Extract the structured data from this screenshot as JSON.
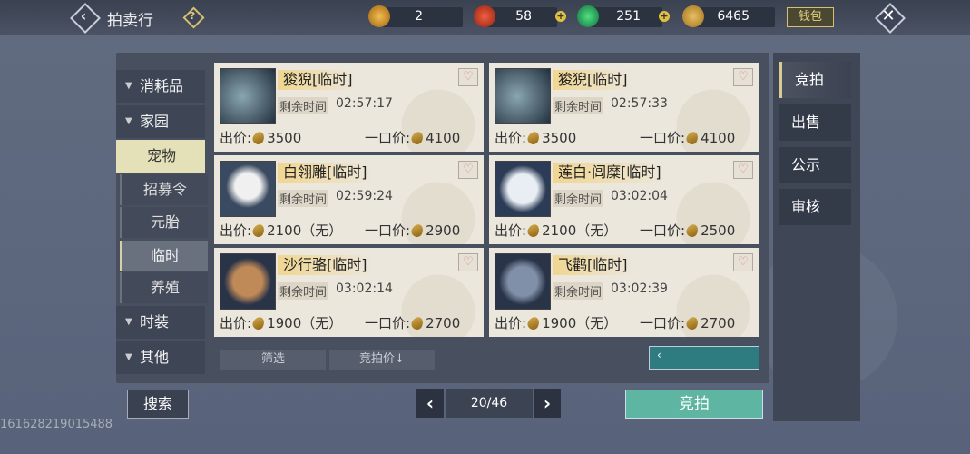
{
  "header": {
    "title": "拍卖行",
    "resources": [
      {
        "icon": "gold-medal-icon",
        "value": "2"
      },
      {
        "icon": "red-orb-icon",
        "value": "58"
      },
      {
        "icon": "jade-icon",
        "value": "251"
      },
      {
        "icon": "coin-icon",
        "value": "6465"
      }
    ],
    "wallet_label": "钱包"
  },
  "categories": [
    {
      "label": "消耗品"
    },
    {
      "label": "家园"
    },
    {
      "label": "宠物"
    },
    {
      "label": "时装"
    },
    {
      "label": "其他"
    }
  ],
  "subcategories": [
    {
      "label": "招募令"
    },
    {
      "label": "元胎"
    },
    {
      "label": "临时"
    },
    {
      "label": "养殖"
    }
  ],
  "labels": {
    "remaining_time": "剩余时间",
    "bid": "出价:",
    "buyout": "一口价:"
  },
  "listings": [
    {
      "name": "狻猊[临时]",
      "time": "02:57:17",
      "bid": "3500",
      "buyout": "4100"
    },
    {
      "name": "狻猊[临时]",
      "time": "02:57:33",
      "bid": "3500",
      "buyout": "4100"
    },
    {
      "name": "白翎雕[临时]",
      "time": "02:59:24",
      "bid": "2100（无）",
      "buyout": "2900"
    },
    {
      "name": "莲白·闾糜[临时]",
      "time": "03:02:04",
      "bid": "2100（无）",
      "buyout": "2500"
    },
    {
      "name": "沙行骆[临时]",
      "time": "03:02:14",
      "bid": "1900（无）",
      "buyout": "2700"
    },
    {
      "name": "飞鹳[临时]",
      "time": "03:02:39",
      "bid": "1900（无）",
      "buyout": "2700"
    }
  ],
  "filter": {
    "filter_label": "筛选",
    "sort_label": "竞拍价↓"
  },
  "footer": {
    "search_label": "搜索",
    "page": "20/46",
    "bid_button": "竞拍"
  },
  "tabs": [
    {
      "label": "竞拍"
    },
    {
      "label": "出售"
    },
    {
      "label": "公示"
    },
    {
      "label": "审核"
    }
  ],
  "watermark": "161628219015488"
}
